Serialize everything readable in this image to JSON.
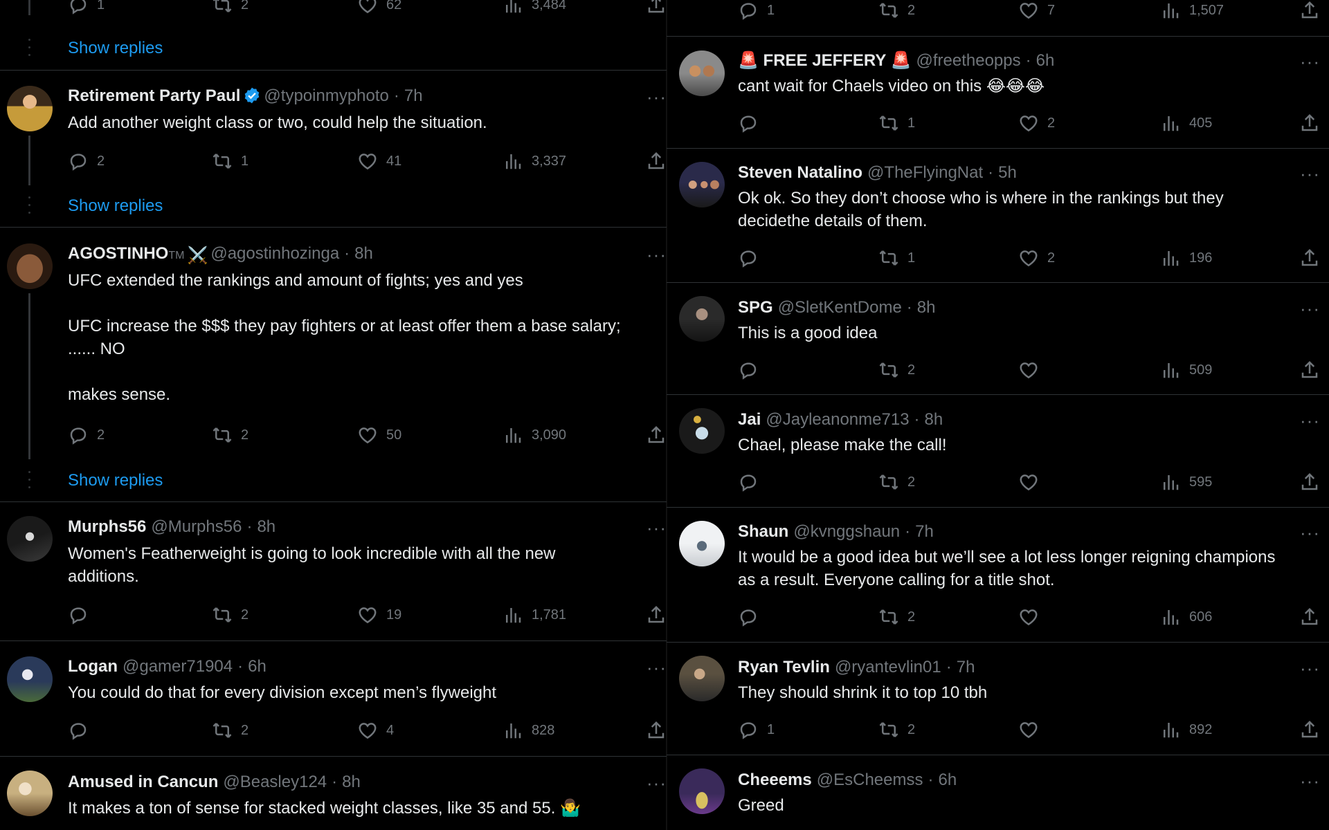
{
  "colors": {
    "background": "#000000",
    "text": "#e7e9ea",
    "muted": "#71767b",
    "link": "#1d9bf0",
    "verified": "#1d9bf0"
  },
  "left": {
    "top_actions": {
      "replies": "1",
      "reposts": "2",
      "likes": "62",
      "views": "3,484"
    },
    "show_replies_1": "Show replies",
    "tweets": [
      {
        "name": "Retirement Party Paul",
        "handle": "@typoinmyphoto",
        "time": "7h",
        "text": "Add another weight class or two, could help the situation.",
        "replies": "2",
        "reposts": "1",
        "likes": "41",
        "views": "3,337",
        "verified": true,
        "show_replies": "Show replies"
      },
      {
        "name": "AGOSTINHO",
        "name_suffix": "TM",
        "emoji": "⚔️",
        "handle": "@agostinhozinga",
        "time": "8h",
        "text": "UFC extended the rankings and amount of fights; yes and yes\n\nUFC increase the $$$ they pay fighters or at least offer them a base salary;\n...... NO\n\nmakes sense.",
        "replies": "2",
        "reposts": "2",
        "likes": "50",
        "views": "3,090",
        "show_replies": "Show replies"
      },
      {
        "name": "Murphs56",
        "handle": "@Murphs56",
        "time": "8h",
        "text": "Women's Featherweight is going to look incredible with all the new\nadditions.",
        "replies": "",
        "reposts": "2",
        "likes": "19",
        "views": "1,781"
      },
      {
        "name": "Logan",
        "handle": "@gamer71904",
        "time": "6h",
        "text": "You could do that for every division except men’s flyweight",
        "replies": "",
        "reposts": "2",
        "likes": "4",
        "views": "828"
      },
      {
        "name": "Amused in Cancun",
        "handle": "@Beasley124",
        "time": "8h",
        "text": "It makes a ton of sense for stacked weight classes, like 35 and 55. 🤷‍♂️"
      }
    ]
  },
  "right": {
    "top_actions": {
      "replies": "1",
      "reposts": "2",
      "likes": "7",
      "views": "1,507"
    },
    "tweets": [
      {
        "name": "🚨 FREE JEFFERY 🚨",
        "handle": "@freetheopps",
        "time": "6h",
        "text": "cant wait for Chaels video on this 😂😂😂",
        "replies": "",
        "reposts": "1",
        "likes": "2",
        "views": "405"
      },
      {
        "name": "Steven Natalino",
        "handle": "@TheFlyingNat",
        "time": "5h",
        "text": "Ok ok. So they don’t choose who is where in the rankings but they\ndecidethe details of them.",
        "replies": "",
        "reposts": "1",
        "likes": "2",
        "views": "196"
      },
      {
        "name": "SPG",
        "handle": "@SletKentDome",
        "time": "8h",
        "text": "This is a good idea",
        "replies": "",
        "reposts": "2",
        "likes": "",
        "views": "509"
      },
      {
        "name": "Jai",
        "handle": "@Jayleanonme713",
        "time": "8h",
        "text": "Chael, please make the call!",
        "replies": "",
        "reposts": "2",
        "likes": "",
        "views": "595"
      },
      {
        "name": "Shaun",
        "handle": "@kvnggshaun",
        "time": "7h",
        "text": "It would be a good idea but we’ll see a lot less longer reigning champions\nas a result. Everyone calling for a title shot.",
        "replies": "",
        "reposts": "2",
        "likes": "",
        "views": "606"
      },
      {
        "name": "Ryan Tevlin",
        "handle": "@ryantevlin01",
        "time": "7h",
        "text": "They should shrink it to top 10 tbh",
        "replies": "1",
        "reposts": "2",
        "likes": "",
        "views": "892"
      },
      {
        "name": "Cheeems",
        "handle": "@EsCheemss",
        "time": "6h",
        "text": "Greed"
      }
    ]
  },
  "ui": {
    "separator_dot": "·",
    "more_glyph": "···"
  },
  "icons": [
    "reply-icon",
    "repost-icon",
    "like-icon",
    "views-icon",
    "share-icon",
    "more-icon",
    "verified-badge-icon"
  ]
}
